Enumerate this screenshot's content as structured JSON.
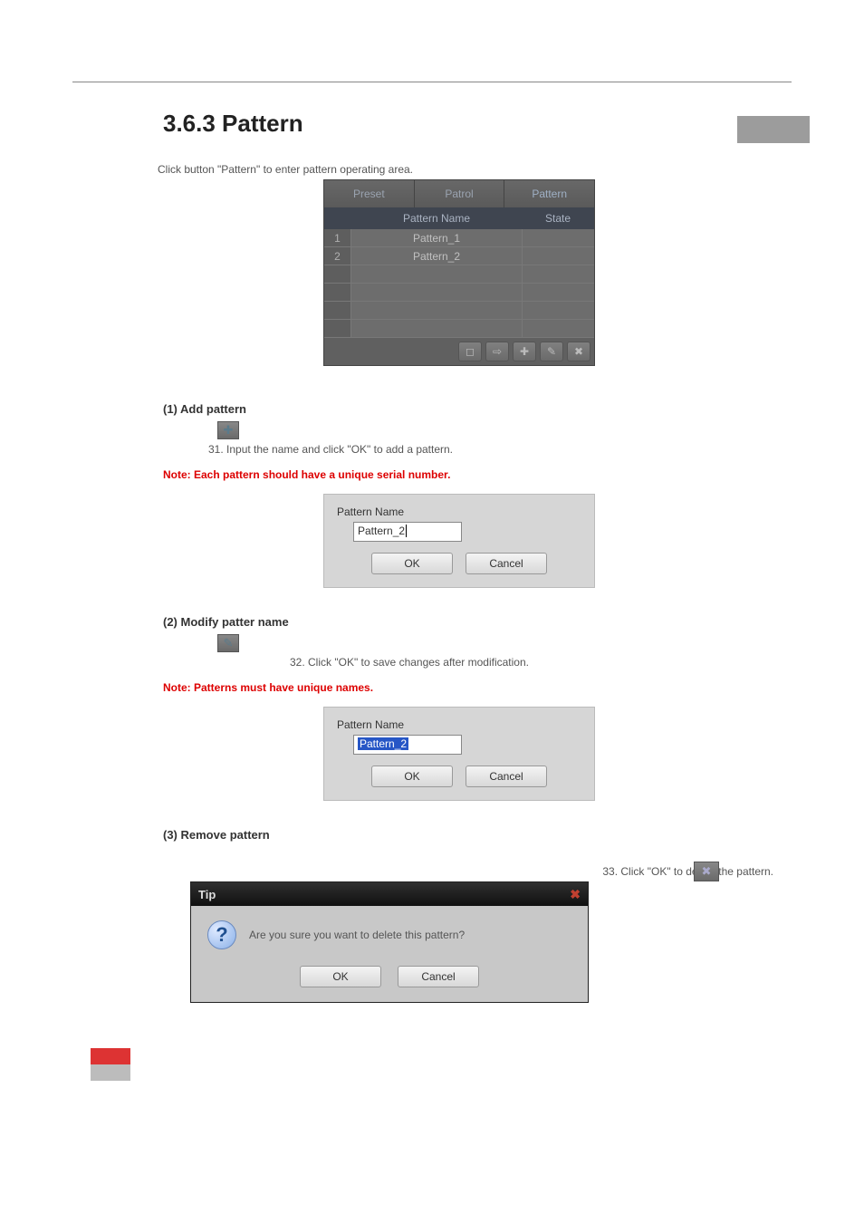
{
  "heading": "3.6.3 Pattern",
  "intro": "Click button \"Pattern\" to enter pattern operating area.",
  "panel": {
    "tabs": {
      "preset": "Preset",
      "patrol": "Patrol",
      "pattern": "Pattern"
    },
    "columns": {
      "name": "Pattern Name",
      "state": "State"
    },
    "rows": [
      {
        "idx": "1",
        "name": "Pattern_1"
      },
      {
        "idx": "2",
        "name": "Pattern_2"
      }
    ],
    "icons": {
      "stop": "◻",
      "play": "⇨",
      "add": "✚",
      "edit": "✎",
      "delete": "✖"
    }
  },
  "s1": {
    "title": "(1) Add pattern",
    "icon": "✚",
    "step": "31. Input the name and click \"OK\" to add a pattern.",
    "note": "Note: Each pattern should have a unique serial number.",
    "dlg_label": "Pattern Name",
    "dlg_value": "Pattern_2",
    "ok": "OK",
    "cancel": "Cancel"
  },
  "s2": {
    "title": "(2) Modify patter name",
    "icon": "✎",
    "step": "32. Click \"OK\" to save changes after modification.",
    "note": "Note: Patterns must have unique names.",
    "dlg_label": "Pattern Name",
    "dlg_value": "Pattern_2",
    "ok": "OK",
    "cancel": "Cancel"
  },
  "s3": {
    "title": "(3) Remove pattern",
    "icon": "✖",
    "step": "33. Click \"OK\" to delete the pattern.",
    "tip_title": "Tip",
    "tip_msg": "Are you sure you want to delete this pattern?",
    "q": "?",
    "ok": "OK",
    "cancel": "Cancel",
    "close": "✖"
  }
}
